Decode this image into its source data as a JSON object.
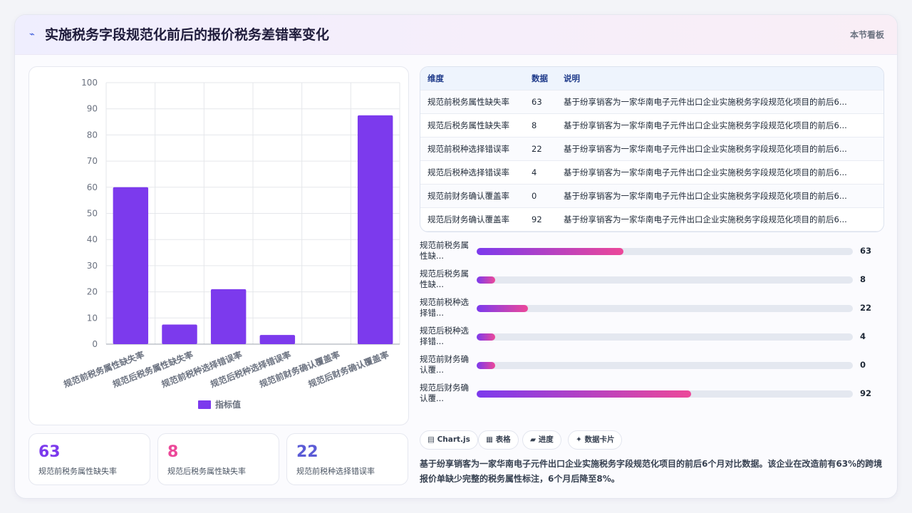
{
  "header": {
    "title": "实施税务字段规范化前后的报价税务差错率变化",
    "board_link": "本节看板"
  },
  "chart_data": {
    "type": "bar",
    "categories": [
      "规范前税务属性缺失率",
      "规范后税务属性缺失率",
      "规范前税种选择错误率",
      "规范后税种选择错误率",
      "规范前财务确认覆盖率",
      "规范后财务确认覆盖率"
    ],
    "series": [
      {
        "name": "指标值",
        "values": [
          60,
          7.5,
          21,
          3.5,
          0,
          87.5
        ],
        "color": "#7c3aed"
      }
    ],
    "ylim": [
      0,
      100
    ],
    "yticks": [
      0,
      10,
      20,
      30,
      40,
      50,
      60,
      70,
      80,
      90,
      100
    ],
    "grid": true,
    "legend": "bottom"
  },
  "stats": [
    {
      "value": "63",
      "label": "规范前税务属性缺失率",
      "color": "#7c3aed"
    },
    {
      "value": "8",
      "label": "规范后税务属性缺失率",
      "color": "#ec4899"
    },
    {
      "value": "22",
      "label": "规范前税种选择错误率",
      "color": "#5b5bd6"
    }
  ],
  "table": {
    "headers": [
      "维度",
      "数据",
      "说明"
    ],
    "rows": [
      [
        "规范前税务属性缺失率",
        "63",
        "基于纷享销客为一家华南电子元件出口企业实施税务字段规范化项目的前后6..."
      ],
      [
        "规范后税务属性缺失率",
        "8",
        "基于纷享销客为一家华南电子元件出口企业实施税务字段规范化项目的前后6..."
      ],
      [
        "规范前税种选择错误率",
        "22",
        "基于纷享销客为一家华南电子元件出口企业实施税务字段规范化项目的前后6..."
      ],
      [
        "规范后税种选择错误率",
        "4",
        "基于纷享销客为一家华南电子元件出口企业实施税务字段规范化项目的前后6..."
      ],
      [
        "规范前财务确认覆盖率",
        "0",
        "基于纷享销客为一家华南电子元件出口企业实施税务字段规范化项目的前后6..."
      ],
      [
        "规范后财务确认覆盖率",
        "92",
        "基于纷享销客为一家华南电子元件出口企业实施税务字段规范化项目的前后6..."
      ]
    ]
  },
  "progress": [
    {
      "label": "规范前税务属性缺...",
      "value": 63,
      "display": "63",
      "fill_percent": 39
    },
    {
      "label": "规范后税务属性缺...",
      "value": 8,
      "display": "8",
      "fill_percent": 5
    },
    {
      "label": "规范前税种选择错...",
      "value": 22,
      "display": "22",
      "fill_percent": 13.6
    },
    {
      "label": "规范后税种选择错...",
      "value": 4,
      "display": "4",
      "fill_percent": 5
    },
    {
      "label": "规范前财务确认覆...",
      "value": 0,
      "display": "0",
      "fill_percent": 5
    },
    {
      "label": "规范后财务确认覆...",
      "value": 92,
      "display": "92",
      "fill_percent": 57
    }
  ],
  "chips": [
    {
      "icon": "chart-icon",
      "glyph": "▤",
      "label": "Chart.js"
    },
    {
      "icon": "table-icon",
      "glyph": "▦",
      "label": "表格"
    },
    {
      "icon": "progress-icon",
      "glyph": "▰",
      "label": "进度"
    },
    {
      "icon": "card-icon",
      "glyph": "✦",
      "label": "数据卡片"
    }
  ],
  "description": "基于纷享销客为一家华南电子元件出口企业实施税务字段规范化项目的前后6个月对比数据。该企业在改造前有63%的跨境报价单缺少完整的税务属性标注，6个月后降至8%。"
}
